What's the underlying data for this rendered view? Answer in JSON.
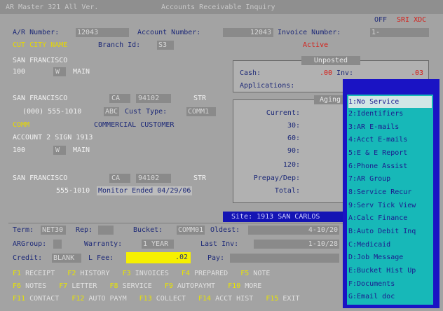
{
  "header": {
    "title": "Accounts Receivable Inquiry",
    "top_left": "AR Master 321 All Ver.",
    "badge_off": "OFF",
    "badge_codes": "SRI XDC"
  },
  "account": {
    "ar_number_label": "A/R Number:",
    "ar_number_value": "12043",
    "account_number_label": "Account Number:",
    "account_number_value": "12043",
    "invoice_number_label": "Invoice Number:",
    "invoice_number_value": "1-",
    "branch_prefix": "CUT CITY NAME",
    "branch_label": "Branch Id:",
    "branch_value": "S3",
    "status": "Active"
  },
  "billing": {
    "line1": "SAN FRANCISCO",
    "line2_num": "100",
    "line2_state": "W",
    "line2_street": "MAIN",
    "city": "SAN FRANCISCO",
    "state": "CA",
    "zip": "94102",
    "zip_ext": "STR",
    "phone": "(000) 555-1010",
    "phone_ext": "ABC",
    "cust_type_label": "Cust Type:",
    "cust_type_value": "COMM1",
    "cust_class_code": "COMM",
    "cust_class_desc": "COMMERCIAL CUSTOMER"
  },
  "service": {
    "line1": "ACCOUNT 2 SIGN 1913",
    "line2_num": "100",
    "line2_state": "W",
    "line2_street": "MAIN",
    "city": "SAN FRANCISCO",
    "state": "CA",
    "zip": "94102",
    "zip_ext": "STR",
    "phone": "555-1010",
    "monitor_text": "Monitor Ended 04/29/06"
  },
  "unposted": {
    "title": "Unposted",
    "cash_label": "Cash:",
    "cash_value": ".00",
    "inv_label": "Inv:",
    "inv_value": ".03",
    "applications_label": "Applications:"
  },
  "aging": {
    "title": "Aging",
    "rows": [
      {
        "label": "Current:"
      },
      {
        "label": "30:"
      },
      {
        "label": "60:"
      },
      {
        "label": "90:"
      },
      {
        "label": "120:"
      },
      {
        "label": "Prepay/Dep:"
      },
      {
        "label": "Total:"
      }
    ]
  },
  "site_bar": "Site: 1913 SAN CARLOS",
  "terms": {
    "term_label": "Term:",
    "term_value": "NET30",
    "rep_label": "Rep:",
    "bucket_label": "Bucket:",
    "bucket_value": "COMM01",
    "oldest_label": "Oldest:",
    "oldest_value": "4-10/20",
    "argroup_label": "ARGroup:",
    "warranty_label": "Warranty:",
    "warranty_value": "1 YEAR",
    "last_inv_label": "Last Inv:",
    "last_inv_value": "1-10/28",
    "credit_label": "Credit:",
    "credit_value": "BLANK",
    "lfee_label": "L Fee:",
    "lfee_value": ".02",
    "pay_label": "Pay:"
  },
  "fkeys": {
    "row1": [
      {
        "key": "F1",
        "text": "RECEIPT"
      },
      {
        "key": "F2",
        "text": "HISTORY"
      },
      {
        "key": "F3",
        "text": "INVOICES"
      },
      {
        "key": "F4",
        "text": "PREPARED"
      },
      {
        "key": "F5",
        "text": "NOTE"
      }
    ],
    "row2": [
      {
        "key": "F6",
        "text": "NOTES"
      },
      {
        "key": "F7",
        "text": "LETTER"
      },
      {
        "key": "F8",
        "text": "SERVICE"
      },
      {
        "key": "F9",
        "text": "AUTOPAYMT"
      },
      {
        "key": "F10",
        "text": "MORE"
      }
    ],
    "row3": [
      {
        "key": "F11",
        "text": "CONTACT"
      },
      {
        "key": "F12",
        "text": "AUTO PAYM"
      },
      {
        "key": "F13",
        "text": "COLLECT"
      },
      {
        "key": "F14",
        "text": "ACCT HIST"
      },
      {
        "key": "F15",
        "text": "EXIT"
      }
    ]
  },
  "menu": {
    "items": [
      {
        "label": "1:No Service",
        "selected": true
      },
      {
        "label": "2:Identifiers",
        "selected": false
      },
      {
        "label": "3:AR E-mails",
        "selected": false
      },
      {
        "label": "4:Acct E-mails",
        "selected": false
      },
      {
        "label": "5:E & E Report",
        "selected": false
      },
      {
        "label": "6:Phone Assist",
        "selected": false
      },
      {
        "label": "7:AR Group",
        "selected": false
      },
      {
        "label": "8:Service Recur",
        "selected": false
      },
      {
        "label": "9:Serv Tick View",
        "selected": false
      },
      {
        "label": "A:Calc Finance",
        "selected": false
      },
      {
        "label": "B:Auto Debit Inq",
        "selected": false
      },
      {
        "label": "C:Medicaid",
        "selected": false
      },
      {
        "label": "D:Job Message",
        "selected": false
      },
      {
        "label": "E:Bucket Hist Up",
        "selected": false
      },
      {
        "label": "F:Documents",
        "selected": false
      },
      {
        "label": "G:Email doc",
        "selected": false
      }
    ]
  },
  "colors": {
    "screen_bg": "#a3a3a3",
    "menu_frame": "#1a13c4",
    "menu_bg": "#17b8b8",
    "highlight_yellow": "#f6f000",
    "text_blue": "#1e2a78",
    "status_red": "#d4201a"
  }
}
